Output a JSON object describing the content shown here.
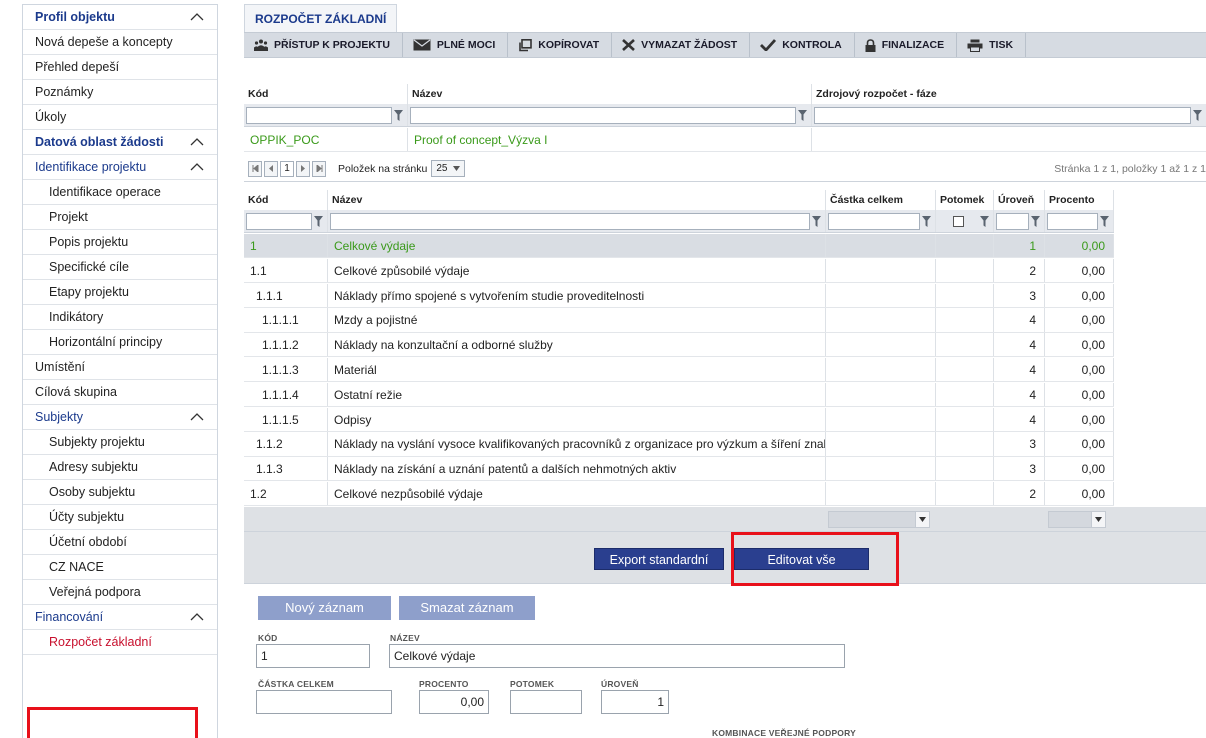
{
  "sidebar": {
    "items": [
      {
        "label": "Profil objektu",
        "type": "section",
        "chevron": true
      },
      {
        "label": "Nová depeše a koncepty",
        "type": "item"
      },
      {
        "label": "Přehled depeší",
        "type": "item"
      },
      {
        "label": "Poznámky",
        "type": "item"
      },
      {
        "label": "Úkoly",
        "type": "item"
      },
      {
        "label": "Datová oblast žádosti",
        "type": "section",
        "chevron": true
      },
      {
        "label": "Identifikace projektu",
        "type": "subsection",
        "chevron": true
      },
      {
        "label": "Identifikace operace",
        "type": "child"
      },
      {
        "label": "Projekt",
        "type": "child"
      },
      {
        "label": "Popis projektu",
        "type": "child"
      },
      {
        "label": "Specifické cíle",
        "type": "child"
      },
      {
        "label": "Etapy projektu",
        "type": "child"
      },
      {
        "label": "Indikátory",
        "type": "child"
      },
      {
        "label": "Horizontální principy",
        "type": "child"
      },
      {
        "label": "Umístění",
        "type": "item"
      },
      {
        "label": "Cílová skupina",
        "type": "item"
      },
      {
        "label": "Subjekty",
        "type": "subsection",
        "chevron": true
      },
      {
        "label": "Subjekty projektu",
        "type": "child"
      },
      {
        "label": "Adresy subjektu",
        "type": "child"
      },
      {
        "label": "Osoby subjektu",
        "type": "child"
      },
      {
        "label": "Účty subjektu",
        "type": "child"
      },
      {
        "label": "Účetní období",
        "type": "child"
      },
      {
        "label": "CZ NACE",
        "type": "child"
      },
      {
        "label": "Veřejná podpora",
        "type": "child"
      },
      {
        "label": "Financování",
        "type": "subsection",
        "chevron": true
      },
      {
        "label": "Rozpočet základní",
        "type": "child",
        "active": true
      }
    ]
  },
  "page_tab": "ROZPOČET ZÁKLADNÍ",
  "toolbar": {
    "buttons": [
      {
        "label": "PŘÍSTUP K PROJEKTU",
        "icon": "people-icon"
      },
      {
        "label": "PLNÉ MOCI",
        "icon": "envelope-icon"
      },
      {
        "label": "KOPÍROVAT",
        "icon": "copy-icon"
      },
      {
        "label": "VYMAZAT ŽÁDOST",
        "icon": "delete-x-icon"
      },
      {
        "label": "KONTROLA",
        "icon": "checkmark-icon"
      },
      {
        "label": "FINALIZACE",
        "icon": "lock-icon"
      },
      {
        "label": "TISK",
        "icon": "printer-icon"
      }
    ]
  },
  "budget_grid": {
    "headers": [
      "Kód",
      "Název",
      "Zdrojový rozpočet - fáze"
    ],
    "row": {
      "code": "OPPIK_POC",
      "name": "Proof of concept_Výzva I"
    }
  },
  "pager": {
    "current_page": "1",
    "page_size_label": "Položek na stránku",
    "page_size": "25",
    "status": "Stránka 1 z 1, položky 1 až 1 z 1"
  },
  "items_grid": {
    "headers": [
      "Kód",
      "Název",
      "Částka celkem",
      "Potomek",
      "Úroveň",
      "Procento"
    ],
    "rows": [
      {
        "code": "1",
        "name": "Celkové výdaje",
        "level": "1",
        "percent": "0,00",
        "indent": 0,
        "highlight": true
      },
      {
        "code": "1.1",
        "name": "Celkové způsobilé výdaje",
        "level": "2",
        "percent": "0,00",
        "indent": 0
      },
      {
        "code": "1.1.1",
        "name": "Náklady přímo spojené s vytvořením studie proveditelnosti",
        "level": "3",
        "percent": "0,00",
        "indent": 1
      },
      {
        "code": "1.1.1.1",
        "name": "Mzdy a pojistné",
        "level": "4",
        "percent": "0,00",
        "indent": 2
      },
      {
        "code": "1.1.1.2",
        "name": "Náklady na konzultační a odborné služby",
        "level": "4",
        "percent": "0,00",
        "indent": 2
      },
      {
        "code": "1.1.1.3",
        "name": "Materiál",
        "level": "4",
        "percent": "0,00",
        "indent": 2
      },
      {
        "code": "1.1.1.4",
        "name": "Ostatní režie",
        "level": "4",
        "percent": "0,00",
        "indent": 2
      },
      {
        "code": "1.1.1.5",
        "name": "Odpisy",
        "level": "4",
        "percent": "0,00",
        "indent": 2
      },
      {
        "code": "1.1.2",
        "name": "Náklady na vyslání vysoce kvalifikovaných pracovníků z organizace pro výzkum a šíření znalostí",
        "level": "3",
        "percent": "0,00",
        "indent": 1
      },
      {
        "code": "1.1.3",
        "name": "Náklady na získání a uznání patentů a dalších nehmotných aktiv",
        "level": "3",
        "percent": "0,00",
        "indent": 1
      },
      {
        "code": "1.2",
        "name": "Celkové nezpůsobilé výdaje",
        "level": "2",
        "percent": "0,00",
        "indent": 0
      }
    ]
  },
  "actions": {
    "export_label": "Export standardní",
    "edit_all_label": "Editovat vše"
  },
  "form": {
    "new_record_label": "Nový záznam",
    "delete_record_label": "Smazat záznam",
    "code_label": "KÓD",
    "code_value": "1",
    "name_label": "NÁZEV",
    "name_value": "Celkové výdaje",
    "amount_label": "ČÁSTKA CELKEM",
    "amount_value": "",
    "percent_label": "PROCENTO",
    "percent_value": "0,00",
    "child_label": "POTOMEK",
    "child_value": "",
    "level_label": "ÚROVEŇ",
    "level_value": "1",
    "state_aid_label": "KOMBINACE VEŘEJNÉ PODPORY"
  },
  "colors": {
    "accent_blue": "#1b3a8c",
    "button_blue": "#2a3f8f",
    "highlight_red": "#e8101a",
    "code_green": "#3a9a1a"
  }
}
